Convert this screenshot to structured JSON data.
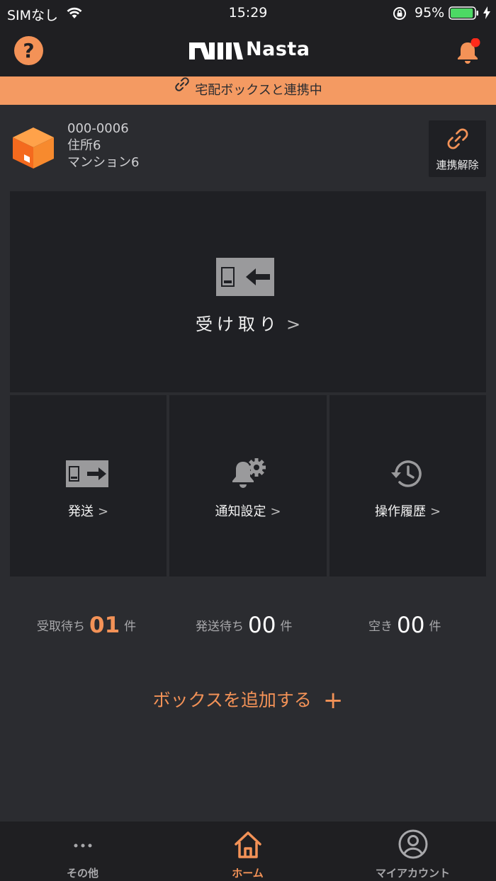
{
  "status_bar": {
    "carrier": "SIMなし",
    "time": "15:29",
    "battery_percent": "95%",
    "battery_level": 0.95
  },
  "header": {
    "help_label": "?",
    "logo_text": "Nasta",
    "notification_badge": true
  },
  "banner": {
    "text": "宅配ボックスと連携中"
  },
  "box": {
    "code": "000-0006",
    "address": "住所6",
    "building": "マンション6",
    "unlink_label": "連携解除"
  },
  "tiles": {
    "receive_label": "受け取り",
    "send_label": "発送",
    "notify_label": "通知設定",
    "history_label": "操作履歴",
    "chevron": ">"
  },
  "counts": {
    "awaiting_pickup_label": "受取待ち",
    "awaiting_pickup_value": "01",
    "awaiting_send_label": "発送待ち",
    "awaiting_send_value": "00",
    "empty_label": "空き",
    "empty_value": "00",
    "unit": "件"
  },
  "add_box": {
    "label": "ボックスを追加する",
    "plus": "+"
  },
  "bottom_nav": {
    "other_label": "その他",
    "home_label": "ホーム",
    "account_label": "マイアカウント",
    "active": "home"
  },
  "colors": {
    "accent": "#f39257",
    "banner": "#f49a62",
    "background": "#2b2c30",
    "tile": "#1f2024"
  }
}
